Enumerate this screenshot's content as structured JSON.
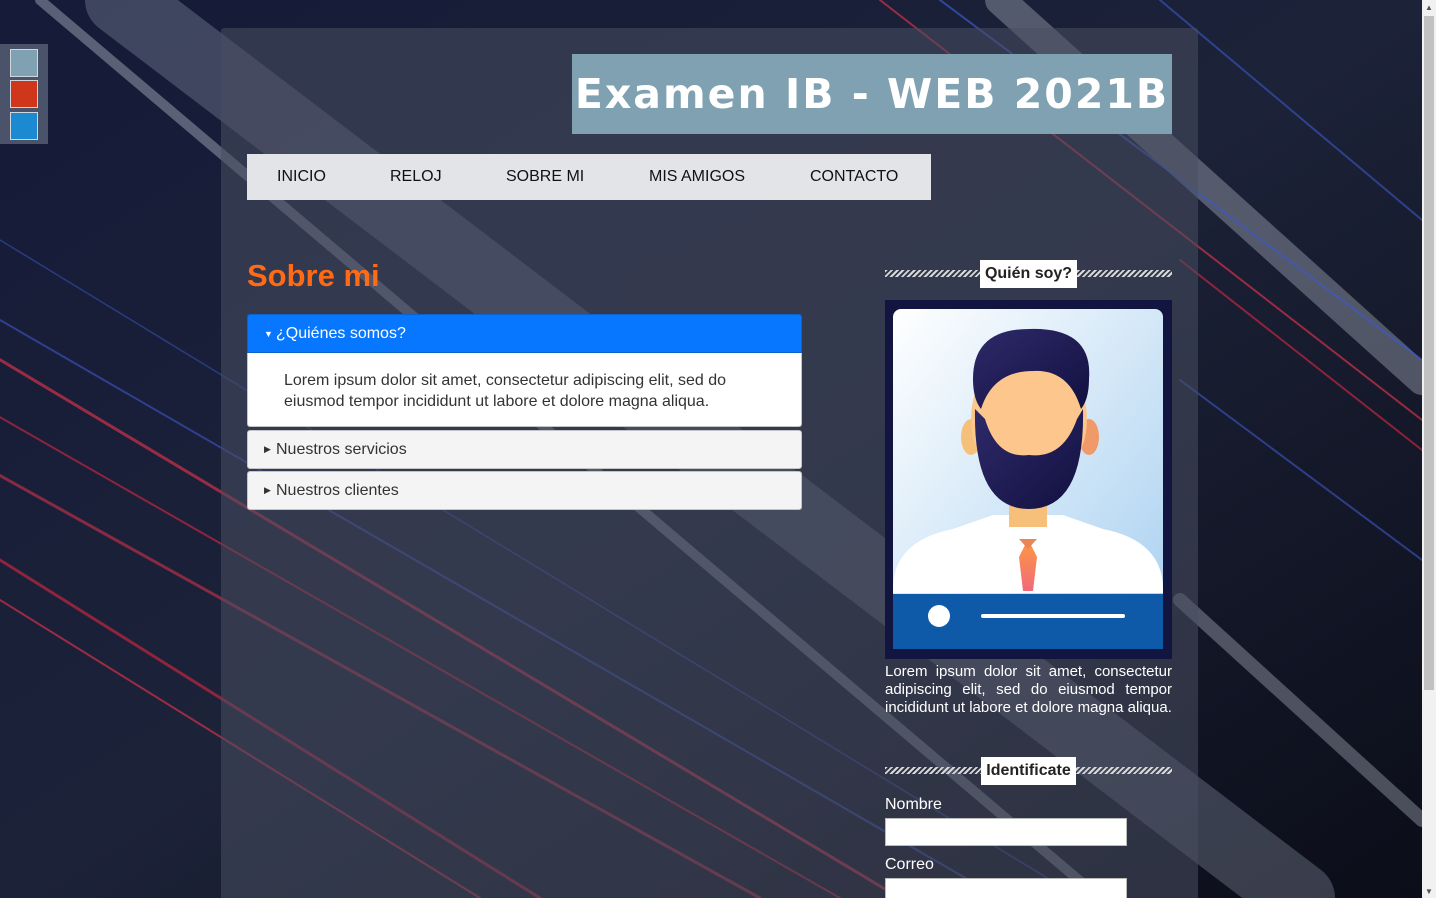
{
  "theme_switcher": {
    "swatches": [
      {
        "name": "gray-blue",
        "color": "#7fa1b1"
      },
      {
        "name": "red",
        "color": "#d0361a"
      },
      {
        "name": "blue",
        "color": "#1b8ad0"
      }
    ]
  },
  "header": {
    "title": "Examen IB - WEB 2021B"
  },
  "nav": {
    "items": [
      {
        "label": "INICIO"
      },
      {
        "label": "RELOJ"
      },
      {
        "label": "SOBRE MI"
      },
      {
        "label": "MIS AMIGOS"
      },
      {
        "label": "CONTACTO"
      }
    ]
  },
  "main": {
    "title": "Sobre mi",
    "accordion": [
      {
        "label": "¿Quiénes somos?",
        "expanded": true,
        "content": "Lorem ipsum dolor sit amet, consectetur adipiscing elit, sed do eiusmod tempor incididunt ut labore et dolore magna aliqua."
      },
      {
        "label": "Nuestros servicios",
        "expanded": false
      },
      {
        "label": "Nuestros clientes",
        "expanded": false
      }
    ]
  },
  "sidebar": {
    "about": {
      "heading": "Quién soy?",
      "text": "Lorem ipsum dolor sit amet, consectetur adipiscing elit, sed do eiusmod tempor incididunt ut labore et dolore magna aliqua."
    },
    "form": {
      "heading": "Identificate",
      "fields": [
        {
          "label": "Nombre",
          "value": ""
        },
        {
          "label": "Correo",
          "value": ""
        }
      ]
    }
  },
  "colors": {
    "accent_orange": "#ff6a14",
    "active_tab": "#0777ff",
    "title_bg": "#7fa1b1",
    "nav_bg": "#e2e4e7"
  }
}
